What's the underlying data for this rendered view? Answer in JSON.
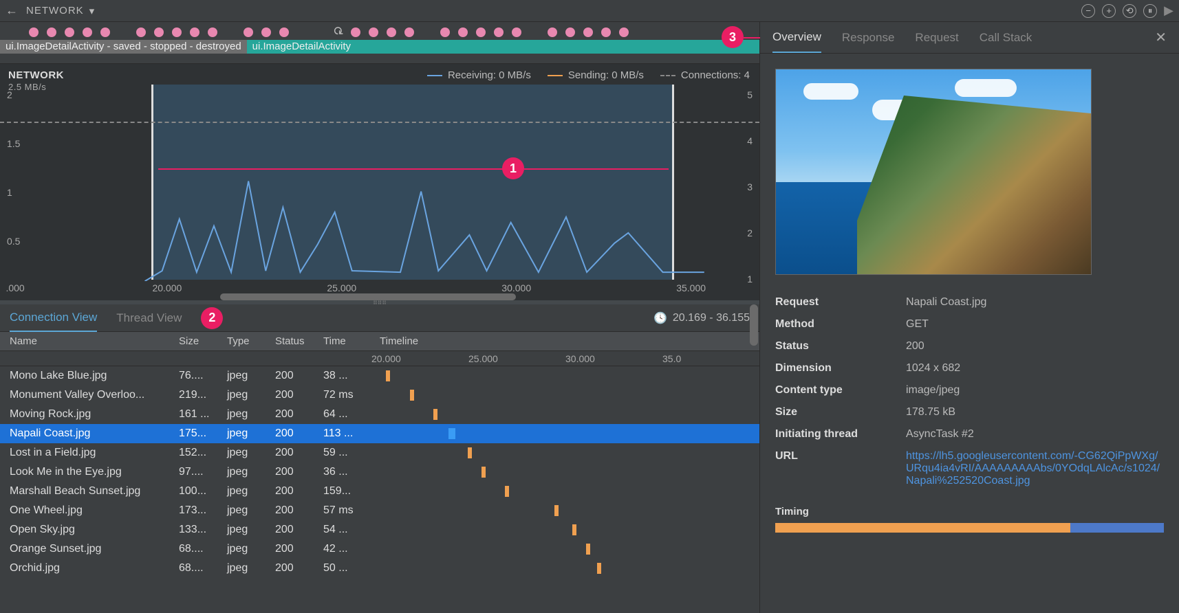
{
  "toolbar": {
    "title": "NETWORK"
  },
  "activity": {
    "left_label": "ui.ImageDetailActivity - saved - stopped - destroyed",
    "right_label": "ui.ImageDetailActivity"
  },
  "chart": {
    "title": "NETWORK",
    "y_unit": "2.5 MB/s",
    "receiving_label": "Receiving: 0 MB/s",
    "sending_label": "Sending: 0 MB/s",
    "connections_label": "Connections: 4",
    "y_left": [
      "2",
      "1.5",
      "1",
      "0.5"
    ],
    "y_right": [
      "5",
      "4",
      "3",
      "2",
      "1"
    ],
    "x_ticks": [
      ".000",
      "20.000",
      "25.000",
      "30.000",
      "35.000"
    ]
  },
  "chart_data": {
    "type": "line",
    "xlabel": "",
    "ylabel": "MB/s",
    "ylim_left": [
      0,
      2.5
    ],
    "yunit_left": "MB/s",
    "ylim_right": [
      0,
      5
    ],
    "yunit_right": "connections",
    "xlim": [
      15,
      37
    ],
    "selection_range": [
      20.169,
      36.155
    ],
    "series": [
      {
        "name": "Receiving",
        "color": "#6aa4e0",
        "x": [
          19.5,
          20.0,
          20.5,
          21.0,
          21.5,
          22.0,
          22.5,
          23.0,
          23.5,
          24.0,
          24.5,
          25.0,
          25.5,
          26.0,
          26.5,
          27.0,
          27.5,
          28.0,
          28.5,
          29.0,
          29.5,
          30.0,
          31.0,
          32.0,
          33.0,
          34.0,
          35.0,
          36.0
        ],
        "values": [
          0,
          0.1,
          0.7,
          0.1,
          0.6,
          0.1,
          1.2,
          0.1,
          0.9,
          0.1,
          0.4,
          0.85,
          0.1,
          0.1,
          0.1,
          0.1,
          1.05,
          0.1,
          0.1,
          0.55,
          0.1,
          0.65,
          0.1,
          0.75,
          0.1,
          0.45,
          0.6,
          0.1
        ]
      },
      {
        "name": "Sending",
        "color": "#f0a050",
        "x": [
          15,
          37
        ],
        "values": [
          0,
          0
        ]
      },
      {
        "name": "Connections",
        "color": "#888888",
        "axis": "right",
        "x": [
          15,
          37
        ],
        "values": [
          4,
          4
        ]
      }
    ]
  },
  "bottom": {
    "tab_connection": "Connection View",
    "tab_thread": "Thread View",
    "range": "20.169 - 36.155",
    "columns": {
      "name": "Name",
      "size": "Size",
      "type": "Type",
      "status": "Status",
      "time": "Time",
      "timeline": "Timeline"
    },
    "timeline_ticks": [
      "20.000",
      "25.000",
      "30.000",
      "35.0"
    ],
    "rows": [
      {
        "name": "Mono Lake Blue.jpg",
        "size": "76....",
        "type": "jpeg",
        "status": "200",
        "time": "38 ...",
        "pos": 9,
        "selected": false
      },
      {
        "name": "Monument Valley Overloo...",
        "size": "219...",
        "type": "jpeg",
        "status": "200",
        "time": "72 ms",
        "pos": 44,
        "selected": false
      },
      {
        "name": "Moving Rock.jpg",
        "size": "161 ...",
        "type": "jpeg",
        "status": "200",
        "time": "64 ...",
        "pos": 78,
        "selected": false
      },
      {
        "name": "Napali Coast.jpg",
        "size": "175...",
        "type": "jpeg",
        "status": "200",
        "time": "113 ...",
        "pos": 100,
        "selected": true
      },
      {
        "name": "Lost in a Field.jpg",
        "size": "152...",
        "type": "jpeg",
        "status": "200",
        "time": "59 ...",
        "pos": 128,
        "selected": false
      },
      {
        "name": "Look Me in the Eye.jpg",
        "size": "97....",
        "type": "jpeg",
        "status": "200",
        "time": "36 ...",
        "pos": 148,
        "selected": false
      },
      {
        "name": "Marshall Beach Sunset.jpg",
        "size": "100...",
        "type": "jpeg",
        "status": "200",
        "time": "159...",
        "pos": 182,
        "selected": false
      },
      {
        "name": "One Wheel.jpg",
        "size": "173...",
        "type": "jpeg",
        "status": "200",
        "time": "57 ms",
        "pos": 254,
        "selected": false
      },
      {
        "name": "Open Sky.jpg",
        "size": "133...",
        "type": "jpeg",
        "status": "200",
        "time": "54 ...",
        "pos": 280,
        "selected": false
      },
      {
        "name": "Orange Sunset.jpg",
        "size": "68....",
        "type": "jpeg",
        "status": "200",
        "time": "42 ...",
        "pos": 300,
        "selected": false
      },
      {
        "name": "Orchid.jpg",
        "size": "68....",
        "type": "jpeg",
        "status": "200",
        "time": "50 ...",
        "pos": 316,
        "selected": false
      }
    ]
  },
  "right": {
    "tabs": {
      "overview": "Overview",
      "response": "Response",
      "request": "Request",
      "callstack": "Call Stack"
    },
    "fields": {
      "request_k": "Request",
      "request_v": "Napali Coast.jpg",
      "method_k": "Method",
      "method_v": "GET",
      "status_k": "Status",
      "status_v": "200",
      "dimension_k": "Dimension",
      "dimension_v": "1024 x 682",
      "ctype_k": "Content type",
      "ctype_v": "image/jpeg",
      "size_k": "Size",
      "size_v": "178.75 kB",
      "thread_k": "Initiating thread",
      "thread_v": "AsyncTask #2",
      "url_k": "URL",
      "url_v": "https://lh5.googleusercontent.com/-CG62QiPpWXg/URqu4ia4vRI/AAAAAAAAAbs/0YOdqLAlcAc/s1024/Napali%252520Coast.jpg"
    },
    "timing_label": "Timing"
  },
  "callouts": {
    "one": "1",
    "two": "2",
    "three": "3"
  }
}
